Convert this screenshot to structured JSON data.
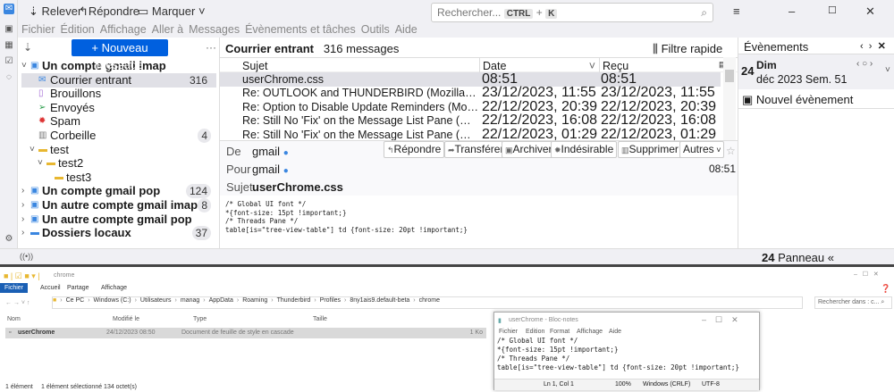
{
  "toolbar": {
    "get_mail": "Relever",
    "reply": "Répondre",
    "tag": "Marquer",
    "search_placeholder": "Rechercher...",
    "key1": "CTRL",
    "plus": "+",
    "key2": "K"
  },
  "menu": [
    "Fichier",
    "Édition",
    "Affichage",
    "Aller à",
    "Messages",
    "Évènements et tâches",
    "Outils",
    "Aide"
  ],
  "folder_pane": {
    "new_message": "+ Nouveau message",
    "more": "···",
    "folders": [
      {
        "name": "Un compte gmail imap",
        "bold": true,
        "level": 0,
        "count": "",
        "icon": "account-icon",
        "twisty": "v"
      },
      {
        "name": "Courrier entrant",
        "level": 1,
        "count": "316",
        "icon": "inbox-icon",
        "selected": true
      },
      {
        "name": "Brouillons",
        "level": 1,
        "count": "",
        "icon": "drafts-icon"
      },
      {
        "name": "Envoyés",
        "level": 1,
        "count": "",
        "icon": "sent-icon"
      },
      {
        "name": "Spam",
        "level": 1,
        "count": "",
        "icon": "spam-icon"
      },
      {
        "name": "Corbeille",
        "level": 1,
        "count": "4",
        "icon": "trash-icon"
      },
      {
        "name": "test",
        "level": 1,
        "count": "",
        "icon": "folder-icon",
        "twisty": "v"
      },
      {
        "name": "test2",
        "level": 2,
        "count": "",
        "icon": "folder-icon",
        "twisty": "v"
      },
      {
        "name": "test3",
        "level": 3,
        "count": "",
        "icon": "folder-icon"
      },
      {
        "name": "Un compte gmail pop",
        "bold": true,
        "level": 0,
        "count": "124",
        "icon": "account-icon",
        "twisty": ">"
      },
      {
        "name": "Un autre compte gmail imap",
        "bold": true,
        "level": 0,
        "count": "8",
        "icon": "account-icon",
        "twisty": ">"
      },
      {
        "name": "Un autre compte gmail pop",
        "bold": true,
        "level": 0,
        "count": "",
        "icon": "account-icon",
        "twisty": ">"
      },
      {
        "name": "Dossiers locaux",
        "bold": true,
        "level": 0,
        "count": "37",
        "icon": "local-folder-icon",
        "twisty": ">"
      }
    ]
  },
  "message_list": {
    "folder": "Courrier entrant",
    "count": "316 messages",
    "quick_filter": "Filtre rapide",
    "columns": [
      "Sujet",
      "Date",
      "Reçu"
    ],
    "rows": [
      {
        "subject": "userChrome.css",
        "date": "08:51",
        "received": "08:51",
        "selected": true
      },
      {
        "subject": "Re: OUTLOOK and THUNDERBIRD (Mozilla Connect ...",
        "date": "23/12/2023, 11:55",
        "received": "23/12/2023, 11:55"
      },
      {
        "subject": "Re: Option to Disable Update Reminders (Mozilla C...",
        "date": "22/12/2023, 20:39",
        "received": "22/12/2023, 20:39"
      },
      {
        "subject": "Re: Still No 'Fix' on the Message List Pane (Mozilla C...",
        "date": "22/12/2023, 16:08",
        "received": "22/12/2023, 16:08"
      },
      {
        "subject": "Re: Still No 'Fix' on the Message List Pane (Mozilla C...",
        "date": "22/12/2023, 01:29",
        "received": "22/12/2023, 01:29"
      }
    ]
  },
  "message_header": {
    "from_label": "De",
    "from": "gmail",
    "to_label": "Pour",
    "to": "gmail",
    "subject_label": "Sujet",
    "subject": "userChrome.css",
    "time": "08:51",
    "buttons": [
      "Répondre",
      "Transférer",
      "Archiver",
      "Indésirable",
      "Supprimer",
      "Autres"
    ]
  },
  "message_body": "/* Global UI font */\n*{font-size: 15pt !important;}\n/* Threads Pane */\ntable[is=\"tree-view-table\"] td {font-size: 20pt !important;}",
  "today_pane": {
    "title": "Évènements",
    "day_num": "24",
    "day_name": "Dim",
    "month_week": "déc 2023 Sem. 51",
    "new_event": "Nouvel évènement",
    "footer_num": "24",
    "footer": "Panneau « Aujourd'hui »"
  },
  "explorer": {
    "title": "chrome",
    "tabs": [
      "Fichier",
      "Accueil",
      "Partage",
      "Affichage"
    ],
    "path": [
      "Ce PC",
      "Windows (C:)",
      "Utilisateurs",
      "manag",
      "AppData",
      "Roaming",
      "Thunderbird",
      "Profiles",
      "8ny1ais9.default-beta",
      "chrome"
    ],
    "search_placeholder": "Rechercher dans : c...",
    "columns": [
      "Nom",
      "Modifié le",
      "Type",
      "Taille"
    ],
    "files": [
      {
        "name": "userChrome",
        "modified": "24/12/2023 08:50",
        "type": "Document de feuille de style en cascade",
        "size": "1 Ko"
      }
    ],
    "status": [
      "1 élément",
      "1 élément sélectionné  134 octet(s)"
    ]
  },
  "notepad": {
    "title": "userChrome - Bloc-notes",
    "menu": [
      "Fichier",
      "Edition",
      "Format",
      "Affichage",
      "Aide"
    ],
    "content": "/* Global UI font */\n*{font-size: 15pt !important;}\n/* Threads Pane */\ntable[is=\"tree-view-table\"] td {font-size: 20pt !important;}",
    "status": [
      "Ln 1, Col 1",
      "100%",
      "Windows (CRLF)",
      "UTF-8"
    ]
  },
  "colors": {
    "accent": "#0060df",
    "selection": "#e0e0e6",
    "explorer_tab": "#1a5fb4"
  }
}
